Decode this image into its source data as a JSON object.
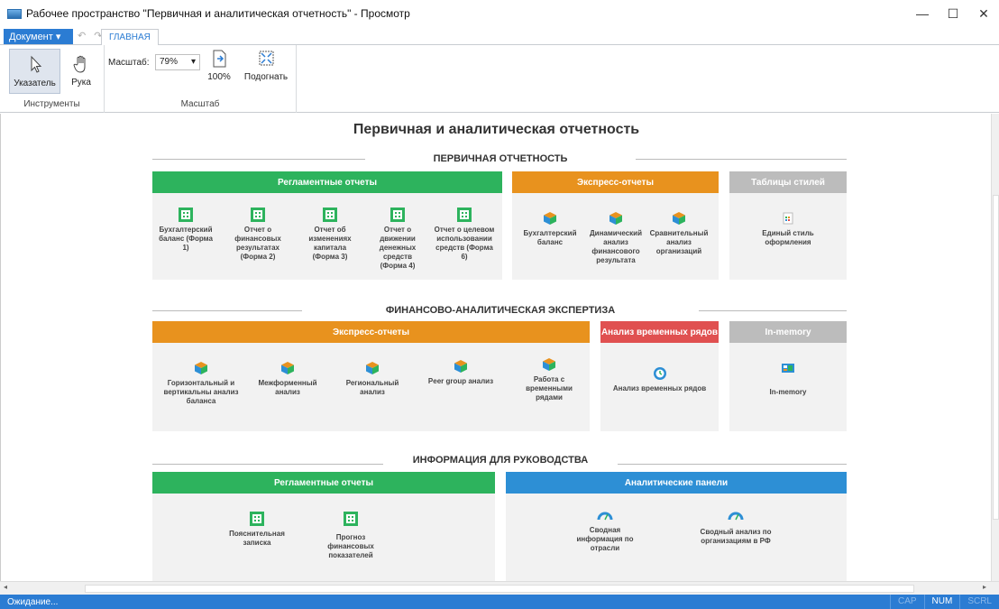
{
  "window": {
    "title": "Рабочее пространство \"Первичная и аналитическая отчетность\" - Просмотр",
    "minimize": "—",
    "maximize": "☐",
    "close": "✕"
  },
  "menu": {
    "document_label": "Документ ▾",
    "undo": "↶",
    "redo": "↷",
    "tab_main": "ГЛАВНАЯ"
  },
  "ribbon": {
    "tools": {
      "pointer": "Указатель",
      "hand": "Рука",
      "group_label": "Инструменты"
    },
    "zoom": {
      "label": "Масштаб:",
      "value": "79%",
      "hundred": "100%",
      "fit": "Подогнать",
      "group_label": "Масштаб"
    }
  },
  "doc": {
    "title": "Первичная и аналитическая отчетность",
    "s1": {
      "title": "ПЕРВИЧНАЯ ОТЧЕТНОСТЬ",
      "p1": {
        "header": "Регламентные отчеты",
        "items": [
          "Бухгалтерский баланс (Форма 1)",
          "Отчет о финансовых результатах (Форма 2)",
          "Отчет об изменениях капитала (Форма 3)",
          "Отчет о движении денежных средств (Форма 4)",
          "Отчет о целевом использовании средств (Форма 6)"
        ]
      },
      "p2": {
        "header": "Экспресс-отчеты",
        "items": [
          "Бухгалтерский баланс",
          "Динамический анализ финансового результата",
          "Сравнительный анализ организаций"
        ]
      },
      "p3": {
        "header": "Таблицы стилей",
        "items": [
          "Единый стиль оформления"
        ]
      }
    },
    "s2": {
      "title": "ФИНАНСОВО-АНАЛИТИЧЕСКАЯ ЭКСПЕРТИЗА",
      "p1": {
        "header": "Экспресс-отчеты",
        "items": [
          "Горизонтальный и вертикальны анализ баланса",
          "Межформенный анализ",
          "Региональный анализ",
          "Peer group анализ",
          "Работа с временными рядами"
        ]
      },
      "p2": {
        "header": "Анализ временных рядов",
        "items": [
          "Анализ временных рядов"
        ]
      },
      "p3": {
        "header": "In-memory",
        "items": [
          "In-memory"
        ]
      }
    },
    "s3": {
      "title": "ИНФОРМАЦИЯ ДЛЯ РУКОВОДСТВА",
      "p1": {
        "header": "Регламентные отчеты",
        "items": [
          "Пояснительная записка",
          "Прогноз финансовых показателей"
        ]
      },
      "p2": {
        "header": "Аналитические панели",
        "items": [
          "Сводная информация по отрасли",
          "Сводный анализ по организациям в РФ"
        ]
      }
    }
  },
  "status": {
    "text": "Ожидание...",
    "cap": "CAP",
    "num": "NUM",
    "scrl": "SCRL"
  },
  "colors": {
    "green": "#2db35d",
    "orange": "#e8921e",
    "gray": "#bcbcbc",
    "red": "#e05050",
    "blue": "#2d8fd5",
    "status": "#2b7cd3"
  }
}
